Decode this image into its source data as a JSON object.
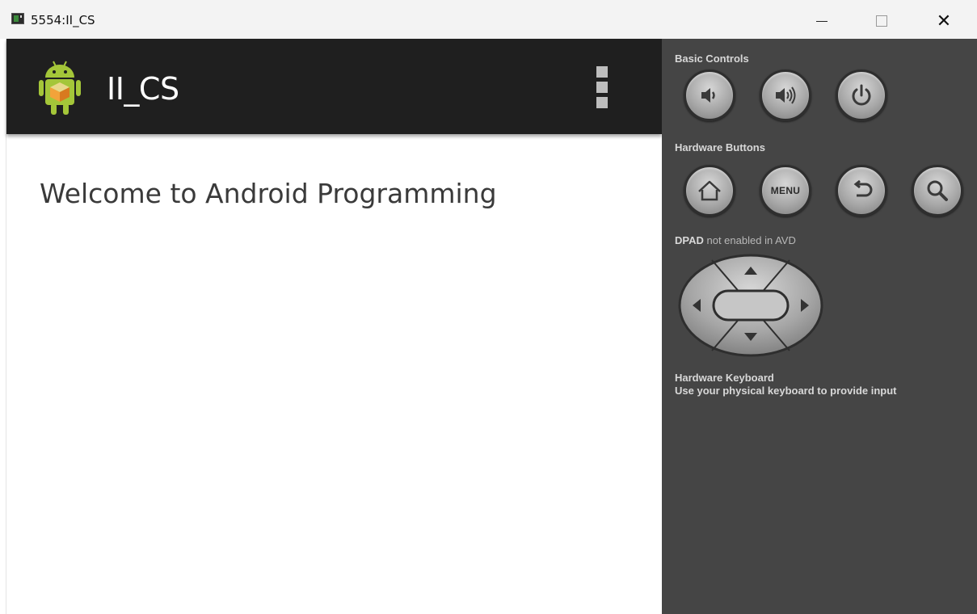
{
  "window": {
    "title": "5554:II_CS"
  },
  "app": {
    "action_bar_title": "II_CS",
    "body_text": "Welcome to Android Programming"
  },
  "panel": {
    "basic_controls_label": "Basic Controls",
    "hardware_buttons_label": "Hardware Buttons",
    "dpad_label_prefix": "DPAD",
    "dpad_label_suffix": "not enabled in AVD",
    "keyboard_title": "Hardware Keyboard",
    "keyboard_hint": "Use your physical keyboard to provide input",
    "menu_button_label": "MENU"
  },
  "icons": {
    "volume_down": "volume-down-icon",
    "volume_up": "volume-up-icon",
    "power": "power-icon",
    "home": "home-icon",
    "back": "back-icon",
    "search": "search-icon"
  },
  "colors": {
    "action_bar": "#1f1f1f",
    "panel_bg": "#454545",
    "android_green": "#a4c639"
  }
}
